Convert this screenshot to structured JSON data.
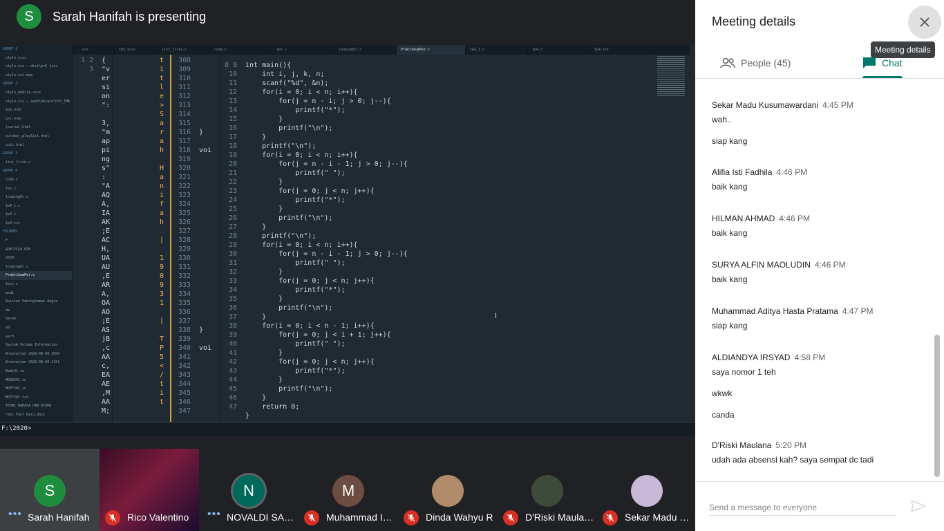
{
  "presenter": {
    "initial": "S",
    "title": "Sarah Hanifah is presenting"
  },
  "screen": {
    "tree": [
      {
        "t": "GROUP 1",
        "g": true
      },
      {
        "t": "style.scss"
      },
      {
        "t": "style.css — dist\\pr6 scss"
      },
      {
        "t": "style.css.map"
      },
      {
        "t": "GROUP 2",
        "g": true
      },
      {
        "t": "style_mobile.scss"
      },
      {
        "t": "style.css — sem3\\Desain\\UTS_TMK"
      },
      {
        "t": "tp5.html"
      },
      {
        "t": "prt.html"
      },
      {
        "t": "journal.html"
      },
      {
        "t": "october_playlist.html"
      },
      {
        "t": "cuti.html"
      },
      {
        "t": "GROUP 3",
        "g": true
      },
      {
        "t": "list_lirik.c"
      },
      {
        "t": "GROUP 4",
        "g": true
      },
      {
        "t": "code.c"
      },
      {
        "t": "tes.c"
      },
      {
        "t": "loopingEc.c"
      },
      {
        "t": "tp4_1.c"
      },
      {
        "t": "tp4.c"
      },
      {
        "t": "tp4.txt"
      },
      {
        "t": "FOLDERS",
        "g": true
      },
      {
        "t": "F"
      },
      {
        "t": "$RECYCLE.BIN"
      },
      {
        "t": "2020"
      },
      {
        "t": "loopingEc.c"
      },
      {
        "t": "PraktikumPer.c",
        "sel": true
      },
      {
        "t": "test.c"
      },
      {
        "t": "asd1"
      },
      {
        "t": "Asisten Pemrograman Angsa"
      },
      {
        "t": "dw"
      },
      {
        "t": "Sarah"
      },
      {
        "t": "sd"
      },
      {
        "t": "ver3"
      },
      {
        "t": "System Volume Information"
      },
      {
        "t": "Annotation 2020-09-09 2054"
      },
      {
        "t": "Annotation 2020-09-09 2151"
      },
      {
        "t": "Bab141.in"
      },
      {
        "t": "MOD0201.in"
      },
      {
        "t": "MOTF201.in"
      },
      {
        "t": "MOTF201.txt"
      },
      {
        "t": "TEORI BAHASA DAN OTOMA"
      },
      {
        "t": "~Sst Font Baru.docx"
      }
    ],
    "tabs": [
      {
        "label": "...css"
      },
      {
        "label": "tpS.scss"
      },
      {
        "label": "list_lirik.c"
      },
      {
        "label": "code.c"
      },
      {
        "label": "tes.c"
      },
      {
        "label": "loopingEc.c"
      },
      {
        "label": "PraktikumPer.c",
        "active": true
      },
      {
        "label": "tp4_1.c"
      },
      {
        "label": "tp4.c"
      },
      {
        "label": "tp4.txt"
      }
    ],
    "pane1_gutter": "1\n2\n\n\n\n\n\n\n3\n",
    "pane1_text": "{\n\"v\ner\nsi\non\n\":\n\n3,\n\"m\nap\npi\nng\ns\"\n:\n\"A\nAQ\nA,\nIA\nAK\n;E\nAC\nH,\nUA\nAU\n,E\nAR\nA,\nOA\nAO\n;E\nAS\njB\n,c\nAA\nc,\nEA\nAE\n,M\nAA\nM;",
    "pane2_text": "t\ni\nt\nl\ne\n>\nS\na\nr\na\nh\n\nH\na\nn\ni\nf\na\nh\n\n|\n\n1\n9\n0\n9\n3\n1\n\n|\n\nT\nP\n5\n<\n/\nt\ni\nt",
    "pane3_gutter": "308\n309\n310\n311\n312\n313\n314\n315\n316\n317\n318\n319\n320\n321\n322\n323\n324\n325\n326\n327\n328\n329\n330\n331\n332\n333\n334\n335\n336\n337\n338\n339\n340\n341\n342\n343\n344\n345\n346\n347",
    "pane3_text": "\n\n\n\n\n\n\n\n}\n\nvoi\n\n\n\n\n\n\n\n\n\n\n\n\n\n\n\n\n\n\n\n}\n\nvoi\n\n\n\n\n\n",
    "main_gutter": "8\n9\n10\n11\n12\n13\n14\n15\n16\n17\n18\n19\n20\n21\n22\n23\n24\n25\n26\n27\n28\n29\n30\n31\n32\n33\n34\n35\n36\n37\n38\n39\n40\n41\n42\n43\n44\n45\n46\n47",
    "code_lines": [
      "int main(){",
      "    int i, j, k, n;",
      "    scanf(\"%d\", &n);",
      "    for(i = 0; i < n; i++){",
      "        for(j = n - i; j > 0; j--){",
      "            printf(\"*\");",
      "        }",
      "        printf(\"\\n\");",
      "    }",
      "    printf(\"\\n\");",
      "    for(i = 0; i < n; i++){",
      "        for(j = n - i - 1; j > 0; j--){",
      "            printf(\" \");",
      "        }",
      "        for(j = 0; j < n; j++){",
      "            printf(\"*\");",
      "        }",
      "        printf(\"\\n\");",
      "    }",
      "    printf(\"\\n\");",
      "    for(i = 0; i < n; i++){",
      "        for(j = n - i - 1; j > 0; j--){",
      "            printf(\" \");",
      "        }",
      "        for(j = 0; j < n; j++){",
      "            printf(\"*\");",
      "        }",
      "        printf(\"\\n\");",
      "    }",
      "    for(i = 0; i < n - 1; i++){",
      "        for(j = 0; j < i + 1; j++){",
      "            printf(\" \");",
      "        }",
      "        for(j = 0; j < n; j++){",
      "            printf(\"*\");",
      "        }",
      "        printf(\"\\n\");",
      "    }",
      "    return 0;",
      "}"
    ],
    "terminal": "F:\\2020>"
  },
  "participants": [
    {
      "name": "Sarah Hanifah",
      "initial": "S",
      "color": "#1e8e3e",
      "status": "speaking"
    },
    {
      "name": "Rico Valentino",
      "initial": "",
      "color": "",
      "status": "muted",
      "video": true
    },
    {
      "name": "NOVALDI SANDI",
      "initial": "N",
      "color": "#00695c",
      "status": "speaking"
    },
    {
      "name": "Muhammad Iq...",
      "initial": "M",
      "color": "#6d4c41",
      "status": "muted"
    },
    {
      "name": "Dinda Wahyu R",
      "initial": "",
      "color": "#b08c6a",
      "status": "muted"
    },
    {
      "name": "D'Riski Maulana",
      "initial": "",
      "color": "#3e4a3a",
      "status": "muted"
    },
    {
      "name": "Sekar Madu K...",
      "initial": "",
      "color": "#c9b8d8",
      "status": "muted"
    }
  ],
  "panel": {
    "title": "Meeting details",
    "tooltip": "Meeting details",
    "tab_people": "People (45)",
    "tab_chat": "Chat",
    "composer_placeholder": "Send a message to everyone",
    "messages": [
      {
        "sender": "Sekar Madu Kusumawardani",
        "time": "4:45 PM",
        "lines": [
          "wah..",
          "siap kang"
        ]
      },
      {
        "sender": "Alifia Isti Fadhila",
        "time": "4:46 PM",
        "lines": [
          "baik kang"
        ]
      },
      {
        "sender": "HILMAN AHMAD",
        "time": "4:46 PM",
        "lines": [
          "baik kang"
        ]
      },
      {
        "sender": "SURYA ALFIN MAOLUDIN",
        "time": "4:46 PM",
        "lines": [
          "baik kang"
        ]
      },
      {
        "sender": "Muhammad Aditya Hasta Pratama",
        "time": "4:47 PM",
        "lines": [
          "siap kang"
        ]
      },
      {
        "sender": "ALDIANDYA IRSYAD",
        "time": "4:58 PM",
        "lines": [
          "saya nomor 1 teh",
          "wkwk",
          "canda"
        ]
      },
      {
        "sender": "D'Riski Maulana",
        "time": "5:20 PM",
        "lines": [
          "udah ada absensi kah? saya sempat dc tadi"
        ]
      }
    ]
  },
  "colors": {
    "accent": "#00796b",
    "muted_red": "#d93025"
  }
}
